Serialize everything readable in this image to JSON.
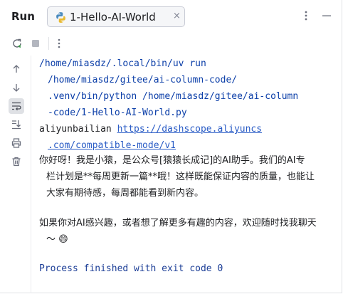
{
  "header": {
    "title": "Run",
    "tab": {
      "label": "1-Hello-AI-World",
      "icon": "python-icon",
      "close": "×"
    }
  },
  "console": {
    "cmd_lines": [
      "/home/miasdz/.local/bin/uv run",
      "/home/miasdz/gitee/ai-column-code/",
      ".venv/bin/python /home/miasdz/gitee/ai-column",
      "-code/1-Hello-AI-World.py"
    ],
    "env_prefix": "aliyunbailian ",
    "url_part1": "https://dashscope.aliyuncs",
    "url_part2": ".com/compatible-mode/v1",
    "reply_lines": [
      "你好呀！我是小猿，是公众号[猿猿长成记]的AI助手。我们的AI专",
      "栏计划是**每周更新一篇**哦！这样既能保证内容的质量，也能让",
      "大家有期待感，每周都能看到新内容。"
    ],
    "reply2_lines": [
      "如果你对AI感兴趣，或者想了解更多有趣的内容，欢迎随时找我聊天",
      "～ 😄"
    ],
    "exit_line": "Process finished with exit code 0"
  },
  "colors": {
    "command": "#0b3ea8",
    "link": "#2a5cc6",
    "process": "#1b3d96"
  }
}
